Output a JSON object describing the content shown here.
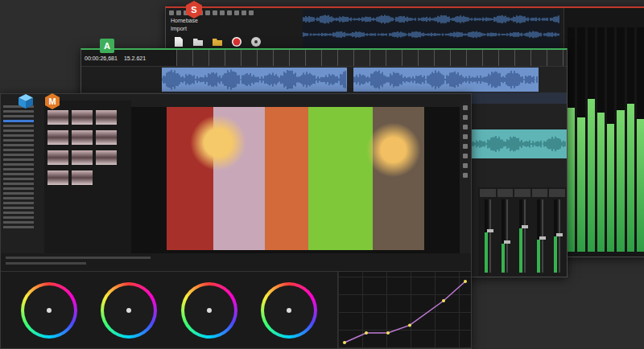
{
  "sound_forge": {
    "badge": "S",
    "menu": "Homebase",
    "section": "Import",
    "waveforms": [
      {
        "level": 0.7
      },
      {
        "level": 0.55
      }
    ],
    "meters": [
      {
        "level": 0.64
      },
      {
        "level": 0.6
      },
      {
        "level": 0.68
      },
      {
        "level": 0.62
      },
      {
        "level": 0.57
      },
      {
        "level": 0.63
      },
      {
        "level": 0.66
      },
      {
        "level": 0.59
      }
    ]
  },
  "acid": {
    "badge": "A",
    "timecode": "00:00:26,681",
    "position": "15.2.621",
    "clips": [
      {
        "level": 0.85
      },
      {
        "level": 0.8
      }
    ],
    "lower_clip": {
      "level": 0.6
    },
    "mixer": [
      {
        "level": 0.55
      },
      {
        "level": 0.4
      },
      {
        "level": 0.6
      },
      {
        "level": 0.45
      },
      {
        "level": 0.5
      }
    ]
  },
  "vegas": {
    "badge": "M",
    "thumbnail_count": 11,
    "wheels": [
      {
        "puck_x": 0,
        "puck_y": 0
      },
      {
        "puck_x": 0,
        "puck_y": 0
      },
      {
        "puck_x": 0,
        "puck_y": 0
      },
      {
        "puck_x": 0,
        "puck_y": 0
      }
    ],
    "curve": [
      [
        0,
        0
      ],
      [
        0.18,
        0.15
      ],
      [
        0.36,
        0.15
      ],
      [
        0.54,
        0.27
      ],
      [
        0.82,
        0.65
      ],
      [
        1,
        0.95
      ]
    ]
  }
}
